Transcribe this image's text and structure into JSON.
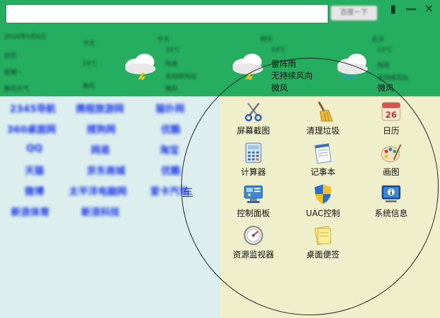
{
  "header": {
    "search_button": "百度一下",
    "window_buttons": [
      "▮",
      "—",
      "✕"
    ]
  },
  "weather": {
    "left_info": [
      "2016年5月6日",
      "农历",
      "星期一",
      "腾讯天气"
    ],
    "days": [
      {
        "title": "今天",
        "temp": "24℃",
        "desc": "阵雨",
        "wind": "微风"
      },
      {
        "title": "明天",
        "temp": "24℃",
        "desc": "雷阵雨",
        "wind": "无持续风向"
      },
      {
        "title": "后天",
        "temp": "22℃",
        "desc": "阵雨",
        "wind": "微风"
      }
    ],
    "overlay_lines": [
      "雷阵雨",
      "无持续风向",
      "微风"
    ],
    "overlay_right": "微风"
  },
  "links": {
    "rows": [
      [
        "2345导航",
        "携程旅游网",
        "猫扑网"
      ],
      [
        "360桌面网",
        "搜狗网",
        "优酷"
      ],
      [
        "QQ",
        "网易",
        "淘宝"
      ],
      [
        "天猫",
        "京东商城",
        "优酷"
      ],
      [
        "微博",
        "太平洋电脑网",
        "爱卡汽车"
      ],
      [
        "新浪体育",
        "新浪科技"
      ]
    ],
    "car": "车"
  },
  "tools": [
    {
      "label": "屏幕截图",
      "icon": "scissors-icon"
    },
    {
      "label": "清理垃圾",
      "icon": "broom-icon"
    },
    {
      "label": "日历",
      "icon": "calendar-icon",
      "day": "26"
    },
    {
      "label": "计算器",
      "icon": "calculator-icon"
    },
    {
      "label": "记事本",
      "icon": "notepad-icon"
    },
    {
      "label": "画图",
      "icon": "palette-icon"
    },
    {
      "label": "控制面板",
      "icon": "control-panel-icon"
    },
    {
      "label": "UAC控制",
      "icon": "uac-shield-icon"
    },
    {
      "label": "系统信息",
      "icon": "system-info-icon"
    },
    {
      "label": "资源监视器",
      "icon": "resource-monitor-icon"
    },
    {
      "label": "桌面便签",
      "icon": "sticky-note-icon"
    }
  ]
}
